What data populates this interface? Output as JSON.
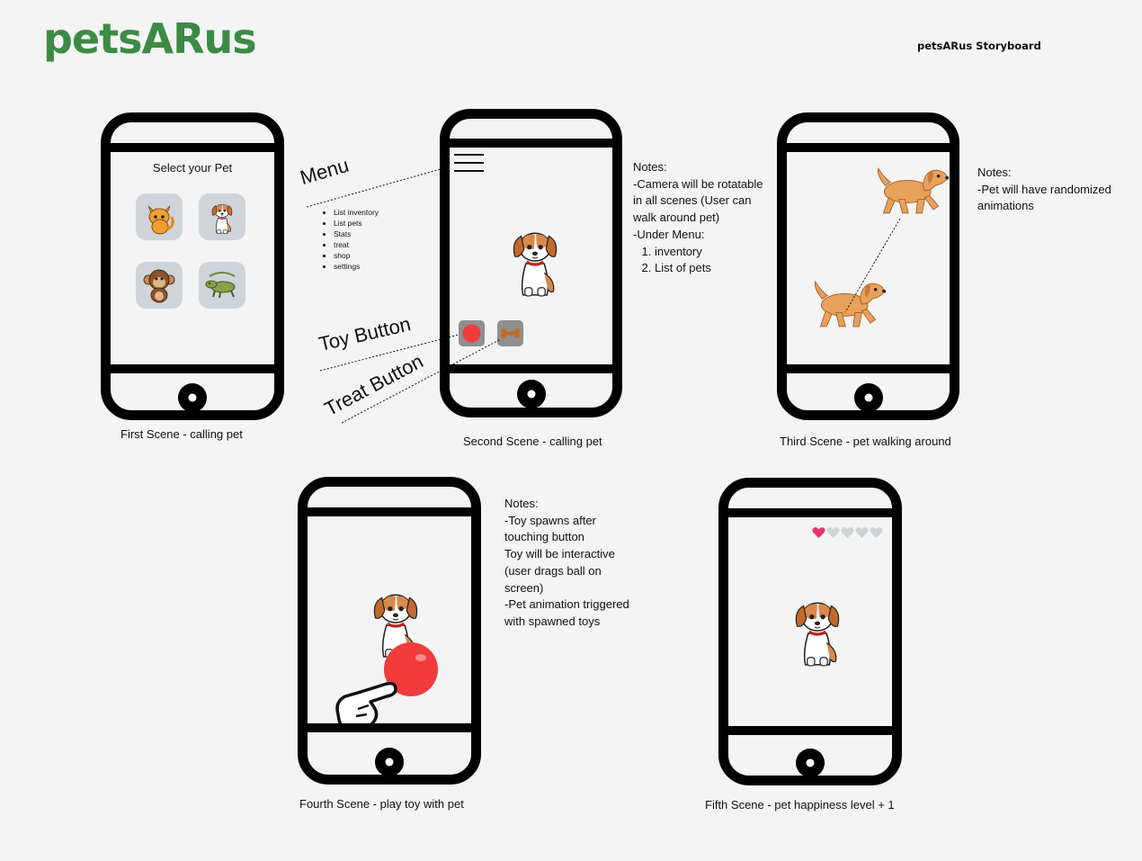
{
  "header": {
    "logo": "petsARus",
    "storyboard_label": "petsARus Storyboard"
  },
  "scene1": {
    "screen_title": "Select your Pet",
    "pets": [
      "cat-icon",
      "dog-icon",
      "monkey-icon",
      "iguana-icon"
    ],
    "caption": "First Scene - calling pet"
  },
  "scene2": {
    "caption": "Second Scene - calling pet",
    "annotations": {
      "menu": "Menu",
      "toy_button": "Toy Button",
      "treat_button": "Treat Button"
    },
    "menu_items": [
      "List inventory",
      "List pets",
      "Stats",
      "treat",
      "shop",
      "settings"
    ],
    "notes": {
      "heading": "Notes:",
      "line1": "-Camera will be rotatable in all scenes (User can walk around pet)",
      "line2": "-Under Menu:",
      "list": [
        "inventory",
        "List of pets"
      ]
    }
  },
  "scene3": {
    "caption": "Third Scene - pet walking around",
    "notes": {
      "heading": "Notes:",
      "line1": "-Pet will have randomized animations"
    }
  },
  "scene4": {
    "caption": "Fourth Scene - play toy with pet",
    "notes": {
      "heading": "Notes:",
      "line1": "-Toy spawns after touching button",
      "line2": "Toy will be interactive (user drags ball on screen)",
      "line3": "-Pet animation triggered with spawned toys"
    }
  },
  "scene5": {
    "caption": "Fifth Scene - pet happiness level + 1",
    "happiness": {
      "filled": 1,
      "total": 5
    }
  },
  "colors": {
    "brand_green": "#3d8a45",
    "heart_pink": "#e8326e",
    "heart_grey": "#cfd4da",
    "ball_red": "#f23b3b",
    "dog_orange": "#d9894a"
  }
}
